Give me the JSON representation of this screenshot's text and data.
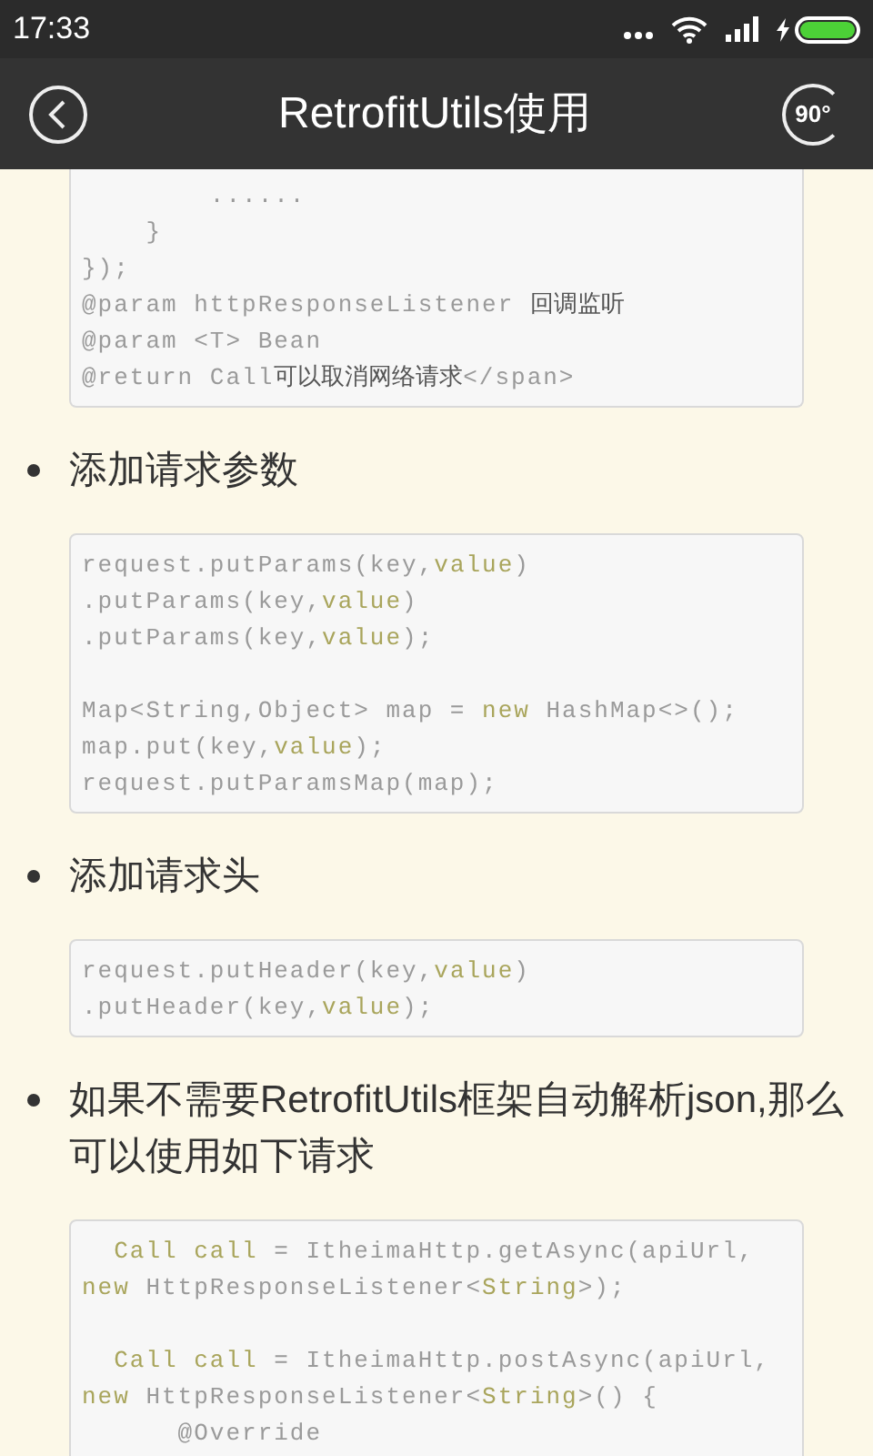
{
  "status_bar": {
    "time": "17:33"
  },
  "header": {
    "title": "RetrofitUtils使用",
    "rotate_label": "90°"
  },
  "sections": [
    {
      "kind": "code",
      "cut_top": true,
      "lines": [
        {
          "kind": "code",
          "segments": [
            {
              "text": "        ......",
              "kind": "plain"
            }
          ]
        },
        {
          "kind": "code",
          "segments": [
            {
              "text": "    }",
              "kind": "plain"
            }
          ]
        },
        {
          "kind": "code",
          "segments": [
            {
              "text": "});",
              "kind": "plain"
            }
          ]
        },
        {
          "kind": "code",
          "segments": [
            {
              "text": "@param httpResponseListener ",
              "kind": "plain"
            },
            {
              "text": "回调监听",
              "kind": "cjk"
            }
          ]
        },
        {
          "kind": "code",
          "segments": [
            {
              "text": "@param <T> Bean",
              "kind": "plain"
            }
          ]
        },
        {
          "kind": "code",
          "segments": [
            {
              "text": "@return Call",
              "kind": "plain"
            },
            {
              "text": "可以取消网络请求",
              "kind": "cjk"
            },
            {
              "text": "</span>",
              "kind": "plain"
            }
          ]
        }
      ]
    },
    {
      "kind": "bullet",
      "text": "添加请求参数"
    },
    {
      "kind": "code",
      "cut_top": false,
      "lines": [
        {
          "kind": "code",
          "segments": [
            {
              "text": "request.putParams(key,",
              "kind": "plain"
            },
            {
              "text": "value",
              "kind": "keyword"
            },
            {
              "text": ")",
              "kind": "plain"
            }
          ]
        },
        {
          "kind": "code",
          "segments": [
            {
              "text": ".putParams(key,",
              "kind": "plain"
            },
            {
              "text": "value",
              "kind": "keyword"
            },
            {
              "text": ")",
              "kind": "plain"
            }
          ]
        },
        {
          "kind": "code",
          "segments": [
            {
              "text": ".putParams(key,",
              "kind": "plain"
            },
            {
              "text": "value",
              "kind": "keyword"
            },
            {
              "text": ");",
              "kind": "plain"
            }
          ]
        },
        {
          "kind": "blank"
        },
        {
          "kind": "code",
          "segments": [
            {
              "text": "Map<String,Object> map = ",
              "kind": "plain"
            },
            {
              "text": "new",
              "kind": "keyword"
            },
            {
              "text": " HashMap<>();",
              "kind": "plain"
            }
          ]
        },
        {
          "kind": "code",
          "segments": [
            {
              "text": "map.put(key,",
              "kind": "plain"
            },
            {
              "text": "value",
              "kind": "keyword"
            },
            {
              "text": ");",
              "kind": "plain"
            }
          ]
        },
        {
          "kind": "code",
          "segments": [
            {
              "text": "request.putParamsMap(map);",
              "kind": "plain"
            }
          ]
        }
      ]
    },
    {
      "kind": "bullet",
      "text": "添加请求头"
    },
    {
      "kind": "code",
      "cut_top": false,
      "lines": [
        {
          "kind": "code",
          "segments": [
            {
              "text": "request.putHeader(key,",
              "kind": "plain"
            },
            {
              "text": "value",
              "kind": "keyword"
            },
            {
              "text": ")",
              "kind": "plain"
            }
          ]
        },
        {
          "kind": "code",
          "segments": [
            {
              "text": ".putHeader(key,",
              "kind": "plain"
            },
            {
              "text": "value",
              "kind": "keyword"
            },
            {
              "text": ");",
              "kind": "plain"
            }
          ]
        }
      ]
    },
    {
      "kind": "bullet",
      "text": "如果不需要RetrofitUtils框架自动解析json,那么可以使用如下请求"
    },
    {
      "kind": "code",
      "cut_top": false,
      "lines": [
        {
          "kind": "code",
          "segments": [
            {
              "text": "  Call call",
              "kind": "keyword"
            },
            {
              "text": " = ItheimaHttp.getAsync(apiUrl,",
              "kind": "plain"
            }
          ]
        },
        {
          "kind": "code",
          "segments": [
            {
              "text": "new",
              "kind": "keyword"
            },
            {
              "text": " HttpResponseListener<",
              "kind": "plain"
            },
            {
              "text": "String",
              "kind": "keyword"
            },
            {
              "text": ">);",
              "kind": "plain"
            }
          ]
        },
        {
          "kind": "blank"
        },
        {
          "kind": "code",
          "segments": [
            {
              "text": "  Call call",
              "kind": "keyword"
            },
            {
              "text": " = ItheimaHttp.postAsync(apiUrl,",
              "kind": "plain"
            }
          ]
        },
        {
          "kind": "code",
          "segments": [
            {
              "text": "new",
              "kind": "keyword"
            },
            {
              "text": " HttpResponseListener<",
              "kind": "plain"
            },
            {
              "text": "String",
              "kind": "keyword"
            },
            {
              "text": ">() {",
              "kind": "plain"
            }
          ]
        },
        {
          "kind": "code",
          "segments": [
            {
              "text": "      @Override",
              "kind": "plain"
            }
          ]
        }
      ]
    }
  ]
}
